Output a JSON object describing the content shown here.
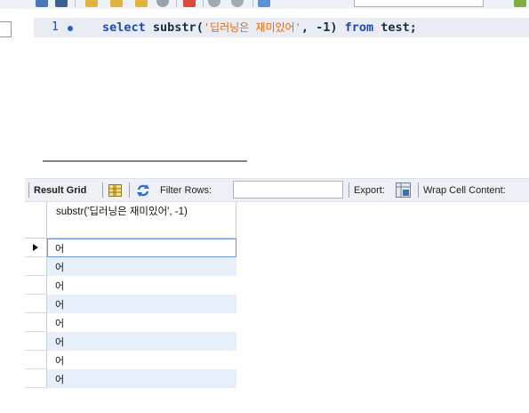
{
  "editor": {
    "line_number": "1",
    "sql": {
      "kw_select": "select",
      "fn": "substr(",
      "string_literal": "'딥러닝은 재미있어'",
      "args_rest": ", -1)",
      "kw_from": "from",
      "table": "test;"
    }
  },
  "result_toolbar": {
    "result_grid_label": "Result Grid",
    "filter_rows_label": "Filter Rows:",
    "filter_value": "",
    "export_label": "Export:",
    "wrap_label": "Wrap Cell Content:"
  },
  "grid": {
    "column_header": "substr('딥러닝은 재미있어', -1)",
    "rows": [
      "어",
      "어",
      "어",
      "어",
      "어",
      "어",
      "어",
      "어"
    ]
  },
  "colors": {
    "keyword": "#1f48b8",
    "string": "#e06a10",
    "row_alt": "#e7effb",
    "toolbar_bg": "#edf0f5"
  },
  "icons": [
    "grid-toggle-icon",
    "refresh-icon",
    "export-icon",
    "execution-marker-icon",
    "row-pointer-icon"
  ]
}
